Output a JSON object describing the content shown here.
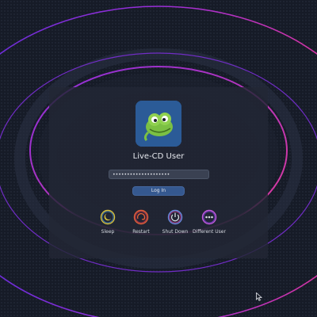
{
  "background": {
    "base_color": "#161b27",
    "ring_colors": [
      "#9b2fd9",
      "#e8368f",
      "#5b2bd6"
    ],
    "dot_color": "#3a4458"
  },
  "user": {
    "name": "Live-CD User",
    "avatar_icon": "chameleon-mascot-icon",
    "avatar_bg": "#2b5b97"
  },
  "password": {
    "value": "••••••••••••••••••••"
  },
  "login": {
    "label": "Log In"
  },
  "actions": [
    {
      "label": "Sleep",
      "icon": "sleep-icon",
      "color": "#d7c13f"
    },
    {
      "label": "Restart",
      "icon": "restart-icon",
      "color": "#e8613a"
    },
    {
      "label": "Shut Down",
      "icon": "shutdown-icon",
      "color": "#6b8be0"
    },
    {
      "label": "Different User",
      "icon": "switch-user-icon",
      "color": "#c45be0"
    }
  ],
  "cursor": {
    "icon": "mouse-pointer-icon"
  }
}
